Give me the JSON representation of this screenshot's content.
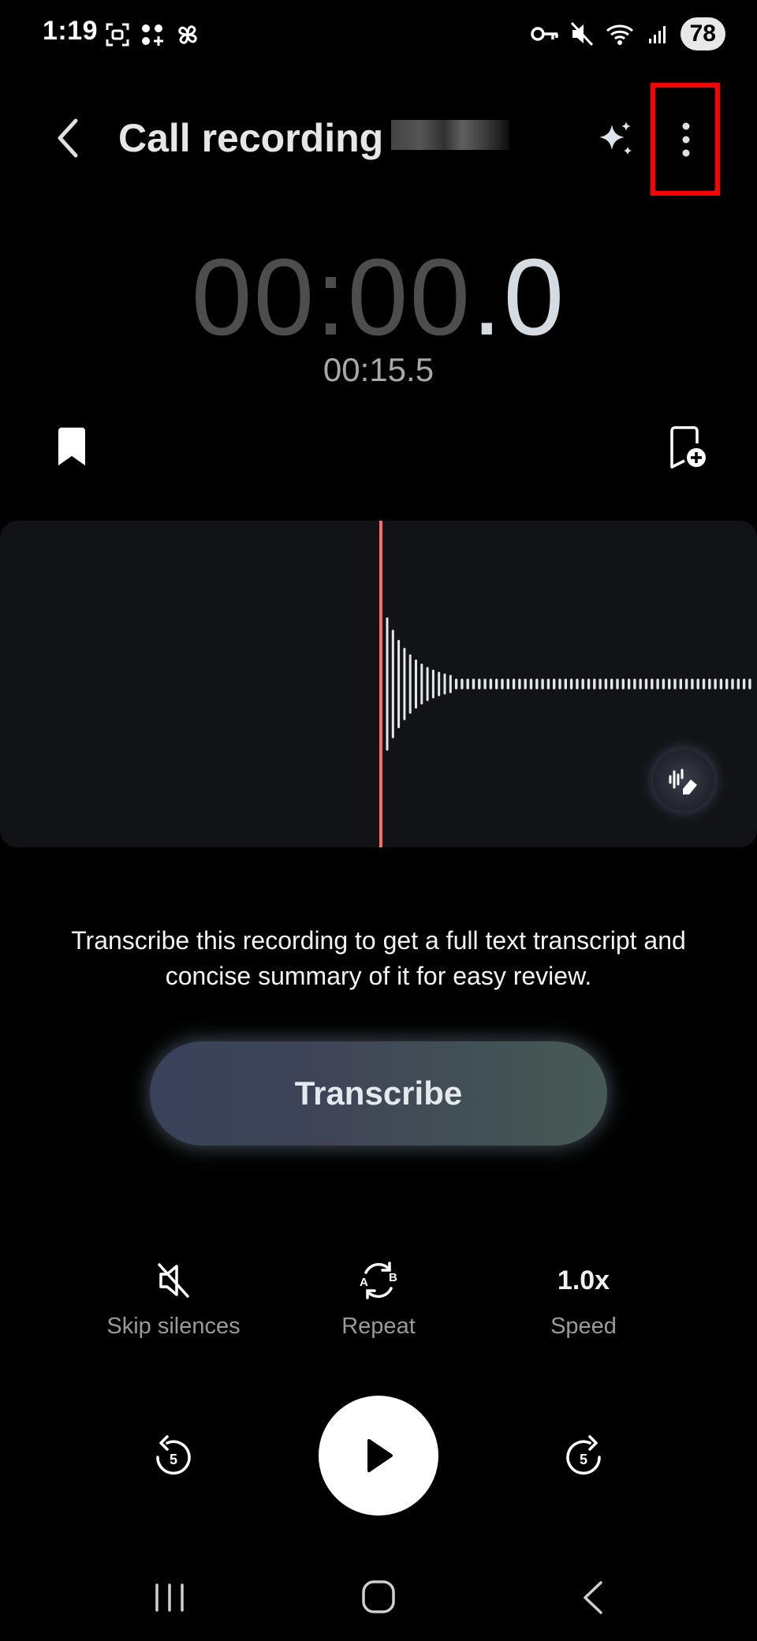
{
  "status_bar": {
    "time": "1:19",
    "battery": "78",
    "icons": [
      "screenshot-icon",
      "apps-icon",
      "pinwheel-icon",
      "vpn-key-icon",
      "mute-icon",
      "wifi-icon",
      "signal-icon"
    ]
  },
  "header": {
    "title": "Call recording",
    "back_icon": "chevron-left-icon",
    "ai_icon": "sparkle-icon",
    "more_icon": "more-vertical-icon"
  },
  "timer": {
    "current_dim": "00:00",
    "current_lit": ".0",
    "total": "00:15.5"
  },
  "transcribe": {
    "description": "Transcribe this recording to get a full text transcript and concise summary of it for easy review.",
    "button_label": "Transcribe"
  },
  "options": {
    "skip_silences_label": "Skip silences",
    "repeat_label": "Repeat",
    "speed_value": "1.0x",
    "speed_label": "Speed",
    "repeat_a": "A",
    "repeat_b": "B"
  },
  "playback": {
    "rewind_seconds": "5",
    "forward_seconds": "5"
  },
  "colors": {
    "background": "#000000",
    "playhead": "#ff6a6a",
    "highlight": "#ff0000"
  }
}
